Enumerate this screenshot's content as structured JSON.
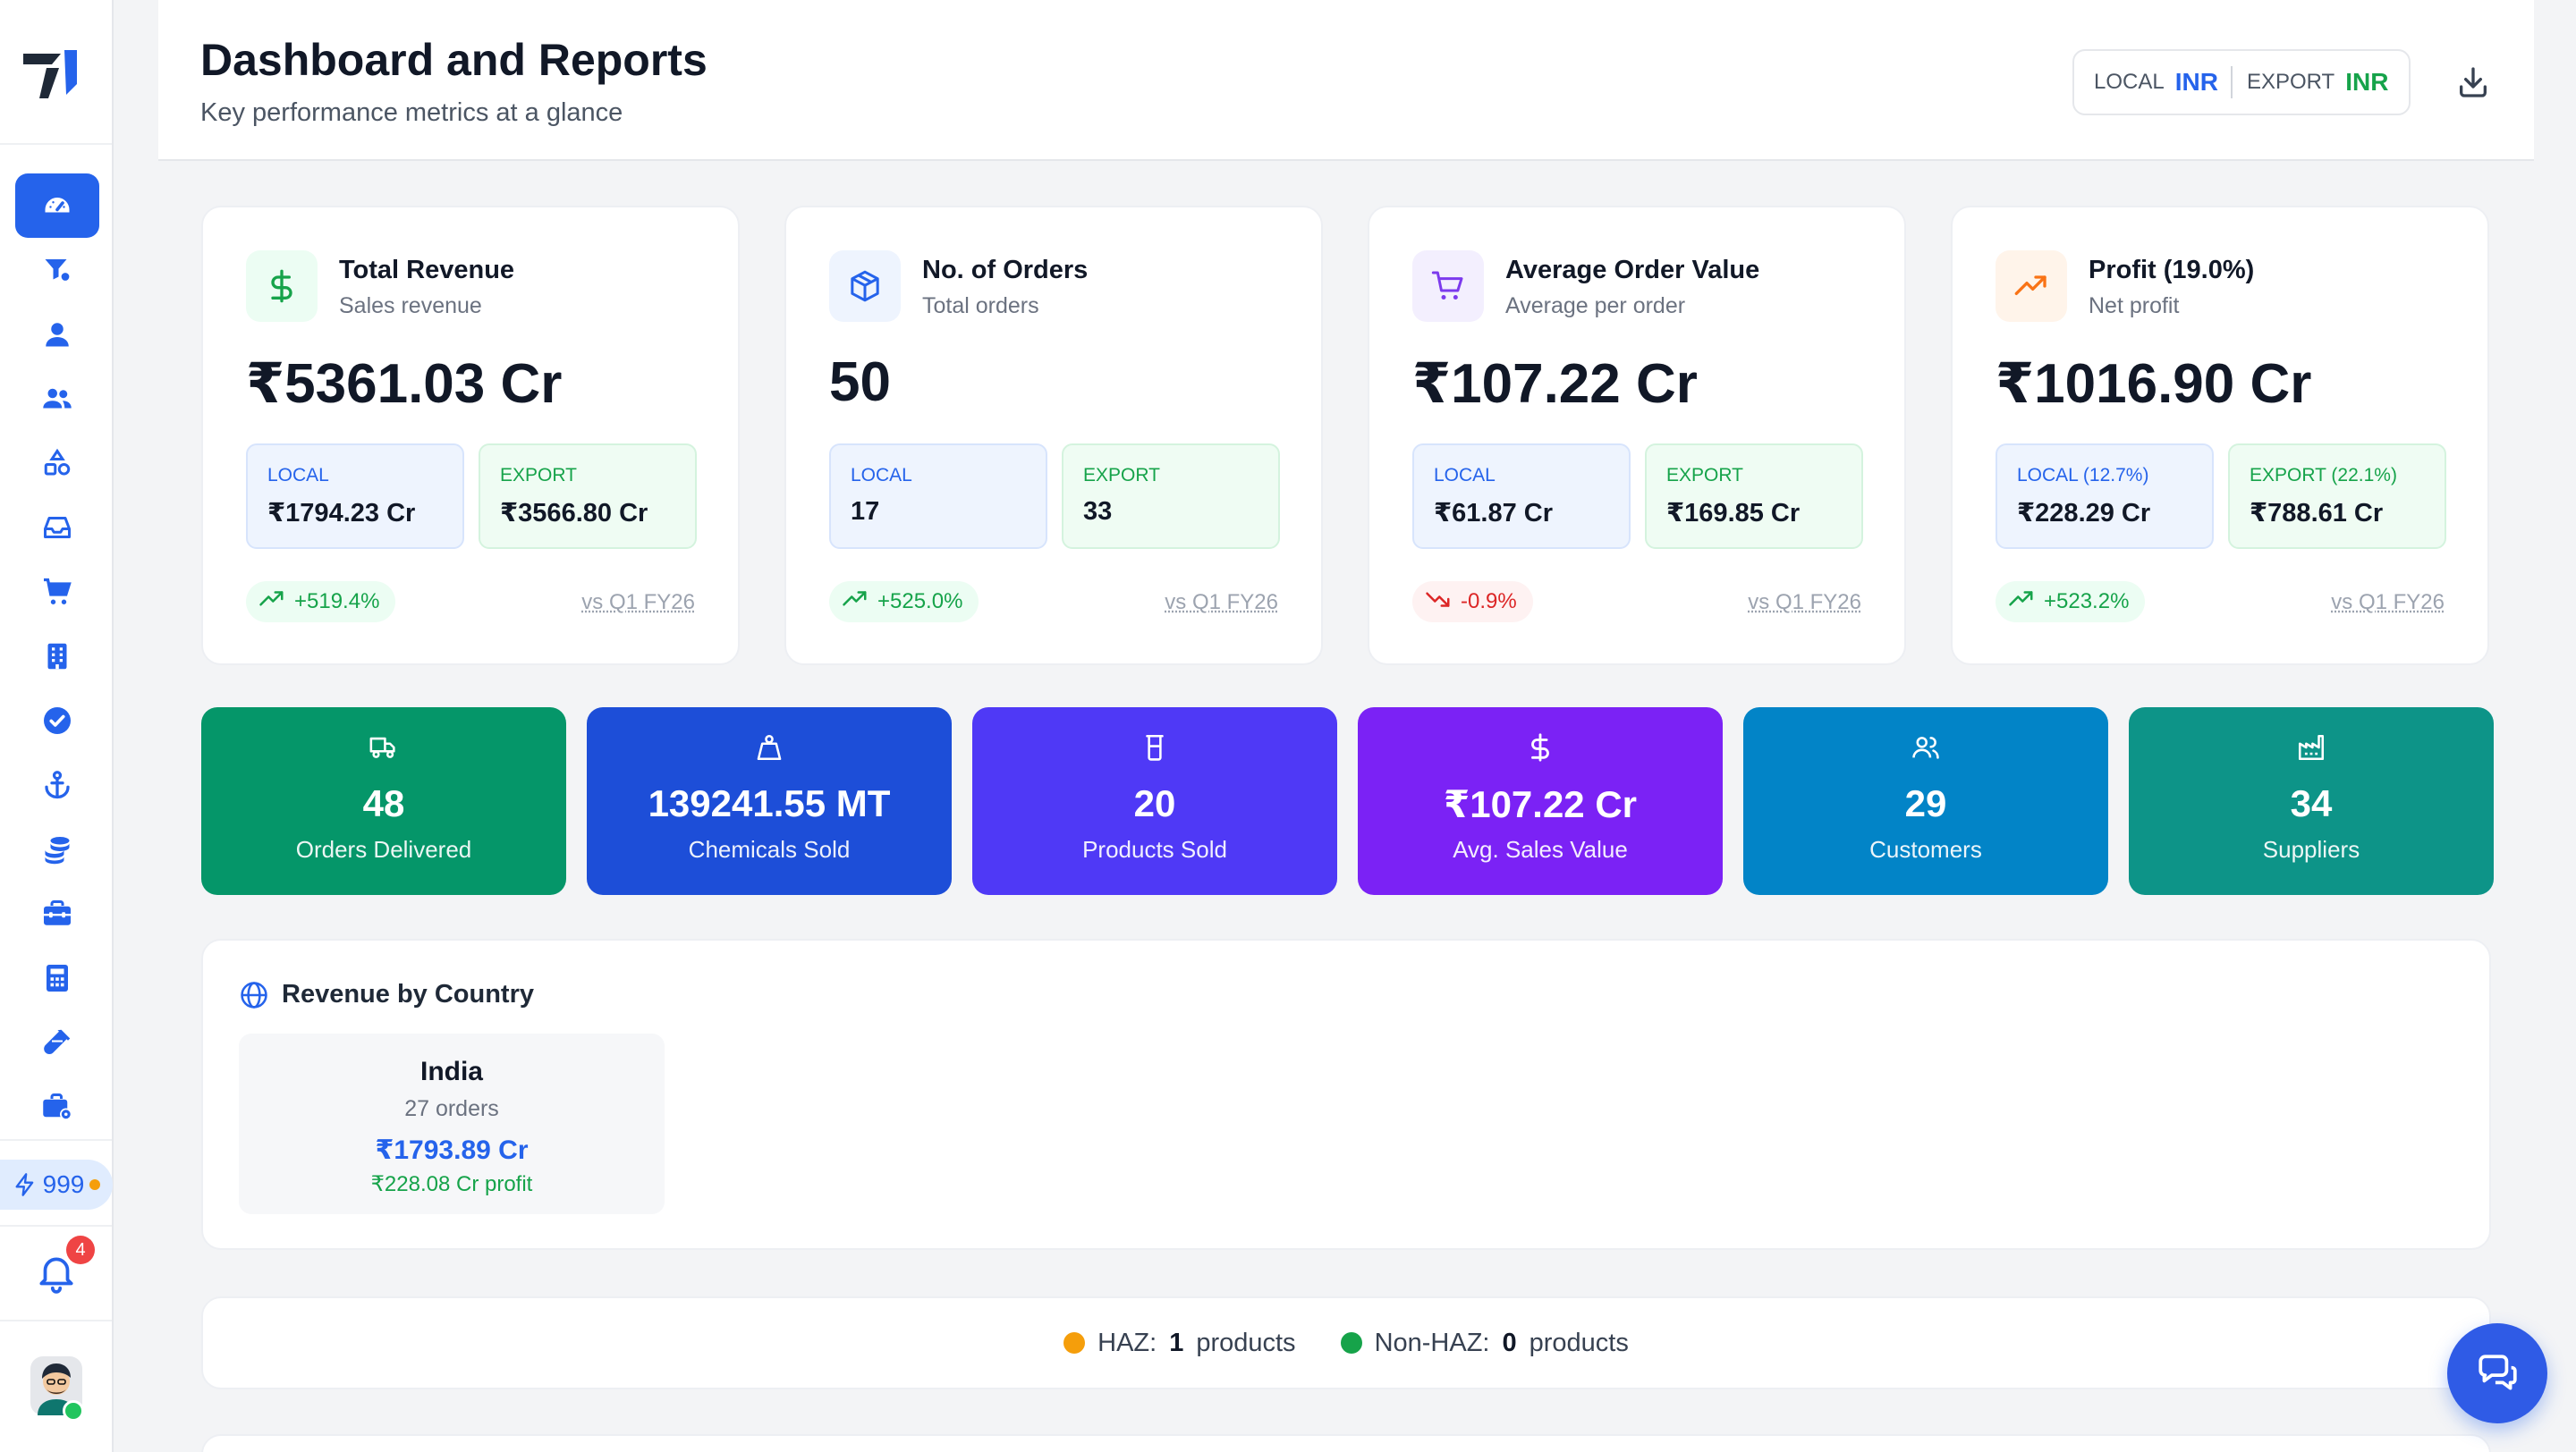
{
  "header": {
    "title": "Dashboard and Reports",
    "subtitle": "Key performance metrics at a glance",
    "currency": {
      "local_label": "LOCAL",
      "local_value": "INR",
      "export_label": "EXPORT",
      "export_value": "INR"
    }
  },
  "sidebar": {
    "credits": "999",
    "notification_count": "4",
    "items": [
      {
        "icon": "dashboard-icon",
        "active": true
      },
      {
        "icon": "filter-settings-icon"
      },
      {
        "icon": "user-icon"
      },
      {
        "icon": "users-icon"
      },
      {
        "icon": "shapes-icon"
      },
      {
        "icon": "inbox-icon"
      },
      {
        "icon": "cart-icon"
      },
      {
        "icon": "building-icon"
      },
      {
        "icon": "check-circle-icon"
      },
      {
        "icon": "anchor-icon"
      },
      {
        "icon": "coins-icon"
      },
      {
        "icon": "toolbox-icon"
      },
      {
        "icon": "calculator-icon"
      },
      {
        "icon": "test-tube-icon"
      },
      {
        "icon": "briefcase-settings-icon"
      }
    ]
  },
  "kpis": [
    {
      "title": "Total Revenue",
      "subtitle": "Sales revenue",
      "value": "₹5361.03 Cr",
      "local_label": "LOCAL",
      "local_value": "₹1794.23 Cr",
      "export_label": "EXPORT",
      "export_value": "₹3566.80 Cr",
      "trend": "+519.4%",
      "trend_dir": "up",
      "compare": "vs Q1 FY26",
      "icon": "dollar-icon",
      "icon_color": "#16a34a",
      "icon_bg": "#ecfdf3"
    },
    {
      "title": "No. of Orders",
      "subtitle": "Total orders",
      "value": "50",
      "local_label": "LOCAL",
      "local_value": "17",
      "export_label": "EXPORT",
      "export_value": "33",
      "trend": "+525.0%",
      "trend_dir": "up",
      "compare": "vs Q1 FY26",
      "icon": "box-icon",
      "icon_color": "#2563eb",
      "icon_bg": "#eef4fe"
    },
    {
      "title": "Average Order Value",
      "subtitle": "Average per order",
      "value": "₹107.22 Cr",
      "local_label": "LOCAL",
      "local_value": "₹61.87 Cr",
      "export_label": "EXPORT",
      "export_value": "₹169.85 Cr",
      "trend": "-0.9%",
      "trend_dir": "down",
      "compare": "vs Q1 FY26",
      "icon": "cart-icon",
      "icon_color": "#7c3aed",
      "icon_bg": "#f3effe"
    },
    {
      "title": "Profit (19.0%)",
      "subtitle": "Net profit",
      "value": "₹1016.90 Cr",
      "local_label": "LOCAL (12.7%)",
      "local_value": "₹228.29 Cr",
      "export_label": "EXPORT (22.1%)",
      "export_value": "₹788.61 Cr",
      "trend": "+523.2%",
      "trend_dir": "up",
      "compare": "vs Q1 FY26",
      "icon": "trending-up-icon",
      "icon_color": "#f97316",
      "icon_bg": "#fff4ea"
    }
  ],
  "stats": [
    {
      "value": "48",
      "label": "Orders Delivered",
      "color": "#059669",
      "icon": "truck-icon"
    },
    {
      "value": "139241.55 MT",
      "label": "Chemicals Sold",
      "color": "#1d4ed8",
      "icon": "weight-icon"
    },
    {
      "value": "20",
      "label": "Products Sold",
      "color": "#4f39f6",
      "icon": "beaker-icon"
    },
    {
      "value": "₹107.22 Cr",
      "label": "Avg. Sales Value",
      "color": "#7b22f5",
      "icon": "dollar-icon"
    },
    {
      "value": "29",
      "label": "Customers",
      "color": "#0284c7",
      "icon": "users-icon"
    },
    {
      "value": "34",
      "label": "Suppliers",
      "color": "#0d9488",
      "icon": "factory-icon"
    }
  ],
  "revenue_by_country": {
    "title": "Revenue by Country",
    "countries": [
      {
        "name": "India",
        "orders": "27 orders",
        "revenue": "₹1793.89 Cr",
        "profit": "₹228.08 Cr profit"
      }
    ]
  },
  "haz": {
    "haz_label": "HAZ:",
    "haz_count": "1",
    "haz_unit": "products",
    "haz_color": "#f59e0b",
    "nonhaz_label": "Non-HAZ:",
    "nonhaz_count": "0",
    "nonhaz_unit": "products",
    "nonhaz_color": "#16a34a"
  }
}
